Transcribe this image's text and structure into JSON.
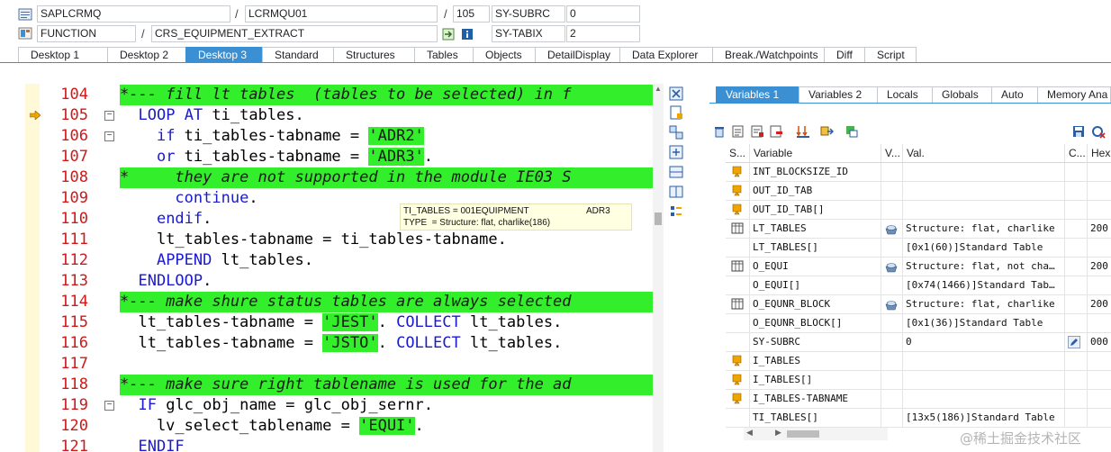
{
  "header": {
    "program": "SAPLCRMQ",
    "include": "LCRMQU01",
    "line": "105",
    "type": "FUNCTION",
    "function_name": "CRS_EQUIPMENT_EXTRACT",
    "subrc_label": "SY-SUBRC",
    "subrc_value": "0",
    "tabix_label": "SY-TABIX",
    "tabix_value": "2",
    "separator": "/"
  },
  "tabs": [
    "Desktop 1",
    "Desktop 2",
    "Desktop 3",
    "Standard",
    "Structures",
    "Tables",
    "Objects",
    "DetailDisplay",
    "Data Explorer",
    "Break./Watchpoints",
    "Diff",
    "Script"
  ],
  "active_tab": "Desktop 3",
  "code_lines": [
    {
      "n": "104",
      "text": "*--- fill lt tables  (tables to be selected) in f",
      "comment": true
    },
    {
      "n": "105",
      "text": "  LOOP AT ti_tables."
    },
    {
      "n": "106",
      "text": "    if ti_tables-tabname = 'ADR2'"
    },
    {
      "n": "107",
      "text": "    or ti_tables-tabname = 'ADR3'."
    },
    {
      "n": "108",
      "text": "*     they are not supported in the module IE03 S",
      "comment": true
    },
    {
      "n": "109",
      "text": "      continue."
    },
    {
      "n": "110",
      "text": "    endif."
    },
    {
      "n": "111",
      "text": "    lt_tables-tabname = ti_tables-tabname."
    },
    {
      "n": "112",
      "text": "    APPEND lt_tables."
    },
    {
      "n": "113",
      "text": "  ENDLOOP."
    },
    {
      "n": "114",
      "text": "*--- make shure status tables are always selected",
      "comment": true
    },
    {
      "n": "115",
      "text": "  lt_tables-tabname = 'JEST'. COLLECT lt_tables."
    },
    {
      "n": "116",
      "text": "  lt_tables-tabname = 'JSTO'. COLLECT lt_tables."
    },
    {
      "n": "117",
      "text": ""
    },
    {
      "n": "118",
      "text": "*--- make sure right tablename is used for the ad",
      "comment": true
    },
    {
      "n": "119",
      "text": "  IF glc_obj_name = glc_obj_sernr."
    },
    {
      "n": "120",
      "text": "    lv_select_tablename = 'EQUI'."
    },
    {
      "n": "121",
      "text": "  ENDIF"
    }
  ],
  "tooltip": {
    "line1_left": "TI_TABLES = 001EQUIPMENT",
    "line1_right": "ADR3",
    "line2": "TYPE  = Structure: flat, charlike(186)"
  },
  "right_tabs": [
    "Variables 1",
    "Variables 2",
    "Locals",
    "Globals",
    "Auto",
    "Memory Ana"
  ],
  "active_right_tab": "Variables 1",
  "grid_headers": [
    "S...",
    "Variable",
    "V...",
    "Val.",
    "C...",
    "Hex"
  ],
  "variables": [
    {
      "icon": "arrow",
      "name": "INT_BLOCKSIZE_ID",
      "v_icon": "",
      "value": "",
      "hex": ""
    },
    {
      "icon": "arrow",
      "name": "OUT_ID_TAB",
      "v_icon": "",
      "value": "",
      "hex": ""
    },
    {
      "icon": "arrow",
      "name": "OUT_ID_TAB[]",
      "v_icon": "",
      "value": "",
      "hex": ""
    },
    {
      "icon": "table",
      "name": "LT_TABLES",
      "v_icon": "struct",
      "value": "Structure: flat, charlike",
      "hex": "200"
    },
    {
      "icon": "",
      "name": "LT_TABLES[]",
      "v_icon": "",
      "value": "[0x1(60)]Standard Table",
      "hex": ""
    },
    {
      "icon": "table",
      "name": "O_EQUI",
      "v_icon": "struct",
      "value": "Structure: flat, not cha…",
      "hex": "200"
    },
    {
      "icon": "",
      "name": "O_EQUI[]",
      "v_icon": "",
      "value": "[0x74(1466)]Standard Tab…",
      "hex": ""
    },
    {
      "icon": "table",
      "name": "O_EQUNR_BLOCK",
      "v_icon": "struct",
      "value": "Structure: flat, charlike",
      "hex": "200"
    },
    {
      "icon": "",
      "name": "O_EQUNR_BLOCK[]",
      "v_icon": "",
      "value": "[0x1(36)]Standard Table",
      "hex": ""
    },
    {
      "icon": "",
      "name": "SY-SUBRC",
      "v_icon": "",
      "value": "0",
      "hex": "000",
      "editable": true
    },
    {
      "icon": "arrow",
      "name": "I_TABLES",
      "v_icon": "",
      "value": "",
      "hex": ""
    },
    {
      "icon": "arrow",
      "name": "I_TABLES[]",
      "v_icon": "",
      "value": "",
      "hex": ""
    },
    {
      "icon": "arrow",
      "name": "I_TABLES-TABNAME",
      "v_icon": "",
      "value": "",
      "hex": ""
    },
    {
      "icon": "",
      "name": "TI_TABLES[]",
      "v_icon": "",
      "value": "[13x5(186)]Standard Table",
      "hex": ""
    }
  ],
  "watermark": "@稀土掘金技术社区"
}
